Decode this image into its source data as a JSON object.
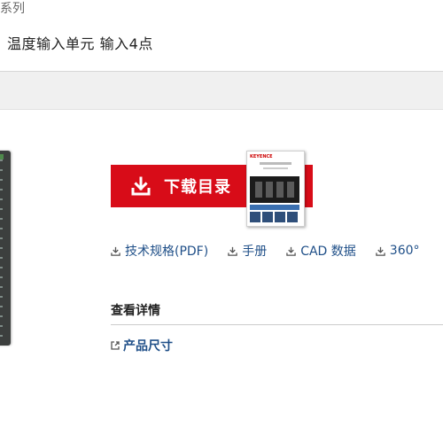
{
  "header": {
    "crumb_fragment": "系列",
    "subtitle": "温度输入单元 输入4点"
  },
  "download": {
    "label": "下载目录",
    "icon": "download-icon",
    "color": "#d80c18"
  },
  "catalog": {
    "brand": "KEYENCE"
  },
  "links": [
    {
      "label": "技术规格(PDF)",
      "icon": "download-icon"
    },
    {
      "label": "手册",
      "icon": "download-icon"
    },
    {
      "label": "CAD 数据",
      "icon": "download-icon"
    },
    {
      "label": "360°",
      "icon": "download-icon"
    }
  ],
  "details": {
    "heading": "查看详情",
    "items": [
      {
        "label": "产品尺寸",
        "icon": "external-link-icon"
      }
    ]
  }
}
